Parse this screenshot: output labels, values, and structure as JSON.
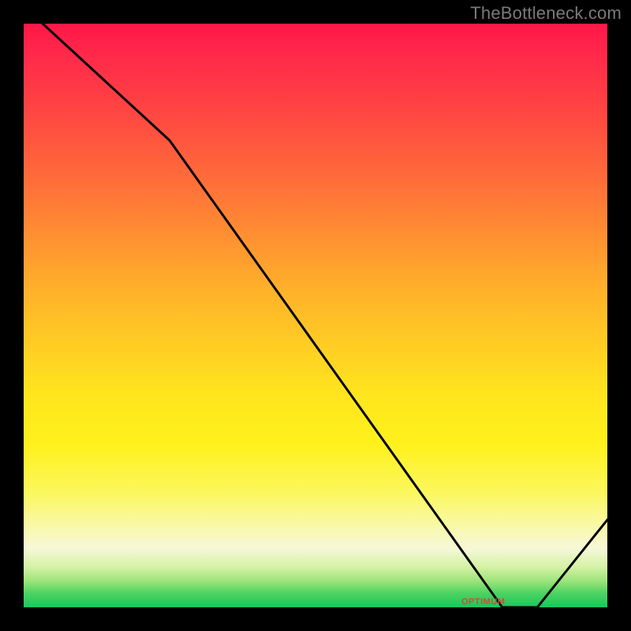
{
  "watermark": "TheBottleneck.com",
  "chart_data": {
    "type": "line",
    "title": "",
    "xlabel": "",
    "ylabel": "",
    "xlim": [
      0,
      100
    ],
    "ylim": [
      0,
      100
    ],
    "grid": false,
    "legend": false,
    "x": [
      0,
      25,
      82,
      88,
      100
    ],
    "values": [
      103,
      80,
      0,
      0,
      15
    ],
    "optimum_range_x": [
      75,
      88
    ],
    "optimum_label": "OPTIMUM"
  }
}
